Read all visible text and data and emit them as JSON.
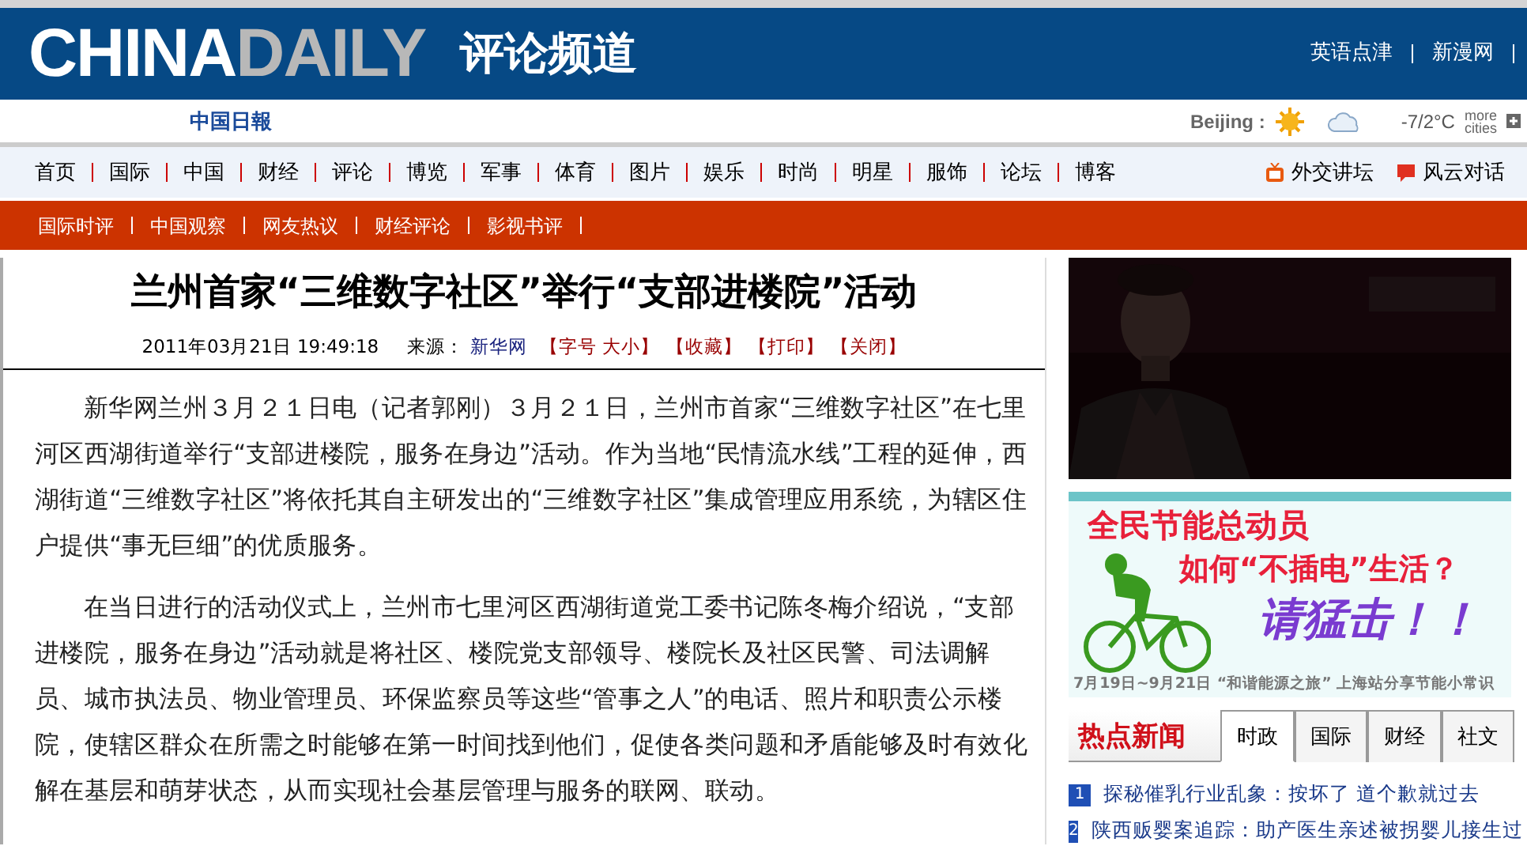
{
  "header": {
    "logo_left": "CHINA",
    "logo_right": "DAILY",
    "channel": "评论频道",
    "links": [
      "英语点津",
      "新漫网"
    ]
  },
  "subheader": {
    "brand": "中国日報",
    "weather": {
      "city": "Beijing :",
      "temp": "-7/2°C",
      "more_top": "more",
      "more_bottom": "cities"
    }
  },
  "nav": {
    "items": [
      "首页",
      "国际",
      "中国",
      "财经",
      "评论",
      "博览",
      "军事",
      "体育",
      "图片",
      "娱乐",
      "时尚",
      "明星",
      "服饰",
      "论坛",
      "博客"
    ],
    "right": [
      {
        "label": "外交讲坛",
        "kind": "tv"
      },
      {
        "label": "风云对话",
        "kind": "chat"
      }
    ]
  },
  "subnav": [
    "国际时评",
    "中国观察",
    "网友热议",
    "财经评论",
    "影视书评"
  ],
  "article": {
    "title": "兰州首家“三维数字社区”举行“支部进楼院”活动",
    "date": "2011年03月21日  19:49:18",
    "source_label": "来源：",
    "source": "新华网",
    "tools": [
      "【字号 大小】",
      "【收藏】",
      "【打印】",
      "【关闭】"
    ],
    "paragraphs": [
      "新华网兰州３月２１日电（记者郭刚）３月２１日，兰州市首家“三维数字社区”在七里河区西湖街道举行“支部进楼院，服务在身边”活动。作为当地“民情流水线”工程的延伸，西湖街道“三维数字社区”将依托其自主研发出的“三维数字社区”集成管理应用系统，为辖区住户提供“事无巨细”的优质服务。",
      "在当日进行的活动仪式上，兰州市七里河区西湖街道党工委书记陈冬梅介绍说，“支部进楼院，服务在身边”活动就是将社区、楼院党支部领导、楼院长及社区民警、司法调解员、城市执法员、物业管理员、环保监察员等这些“管事之人”的电话、照片和职责公示楼院，使辖区群众在所需之时能够在第一时间找到他们，促使各类问题和矛盾能够及时有效化解在基层和萌芽状态，从而实现社会基层管理与服务的联网、联动。"
    ]
  },
  "sidebar": {
    "banner": {
      "line1": "全民节能总动员",
      "line2": "如何“不插电”生活？",
      "line3": "请猛击！！",
      "caption": "7月19日~9月21日 “和谐能源之旅” 上海站分享节能小常识"
    },
    "hot_news": {
      "title": "热点新闻",
      "tabs": [
        {
          "label": "时政",
          "selected": true
        },
        {
          "label": "国际",
          "selected": false
        },
        {
          "label": "财经",
          "selected": false
        },
        {
          "label": "社文",
          "selected": false
        }
      ],
      "items": [
        {
          "rank": "1",
          "title": "探秘催乳行业乱象：按坏了 道个歉就过去"
        },
        {
          "rank": "2",
          "title": "陕西贩婴案追踪：助产医生亲述被拐婴儿接生过"
        }
      ]
    }
  }
}
